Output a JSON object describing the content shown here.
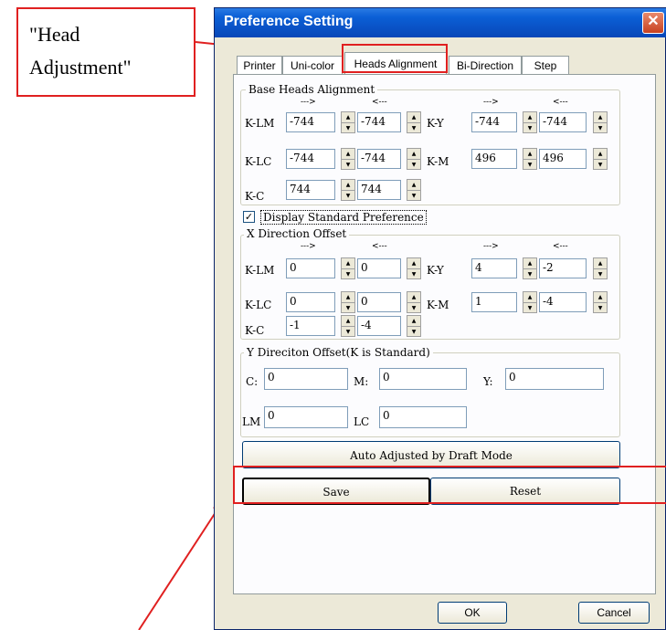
{
  "annotation": {
    "text": "\"Head Adjustment\""
  },
  "window": {
    "title": "Preference Setting",
    "close_glyph": "✕"
  },
  "tabs": [
    "Printer",
    "Uni-color",
    "Heads Alignment",
    "Bi-Direction",
    "Step"
  ],
  "base": {
    "title": "Base Heads Alignment",
    "arrow_right": "--->",
    "arrow_left": "<---",
    "rows": [
      {
        "l1": "K-LM",
        "v1": "-744",
        "v2": "-744",
        "l2": "K-Y",
        "v3": "-744",
        "v4": "-744"
      },
      {
        "l1": "K-LC",
        "v1": "-744",
        "v2": "-744",
        "l2": "K-M",
        "v3": "496",
        "v4": "496"
      },
      {
        "l1": "K-C",
        "v1": "744",
        "v2": "744"
      }
    ]
  },
  "display_standard": {
    "label": "Display Standard Preference",
    "check": "✓"
  },
  "xoffset": {
    "title": "X Direction Offset",
    "arrow_right": "--->",
    "arrow_left": "<---",
    "rows": [
      {
        "l1": "K-LM",
        "v1": "0",
        "v2": "0",
        "l2": "K-Y",
        "v3": "4",
        "v4": "-2"
      },
      {
        "l1": "K-LC",
        "v1": "0",
        "v2": "0",
        "l2": "K-M",
        "v3": "1",
        "v4": "-4"
      },
      {
        "l1": "K-C",
        "v1": "-1",
        "v2": "-4"
      }
    ]
  },
  "yoffset": {
    "title": "Y Direciton Offset(K is Standard)",
    "c_label": "C:",
    "c_value": "0",
    "m_label": "M:",
    "m_value": "0",
    "y_label": "Y:",
    "y_value": "0",
    "lm_label": "LM",
    "lm_value": "0",
    "lc_label": "LC",
    "lc_value": "0"
  },
  "buttons": {
    "auto": "Auto Adjusted by Draft Mode",
    "save": "Save",
    "reset": "Reset",
    "ok": "OK",
    "cancel": "Cancel"
  },
  "spin_glyphs": {
    "up": "▲",
    "down": "▼"
  },
  "colors": {
    "annotation": "#e02020",
    "titlebar": "#0b5fd6"
  }
}
